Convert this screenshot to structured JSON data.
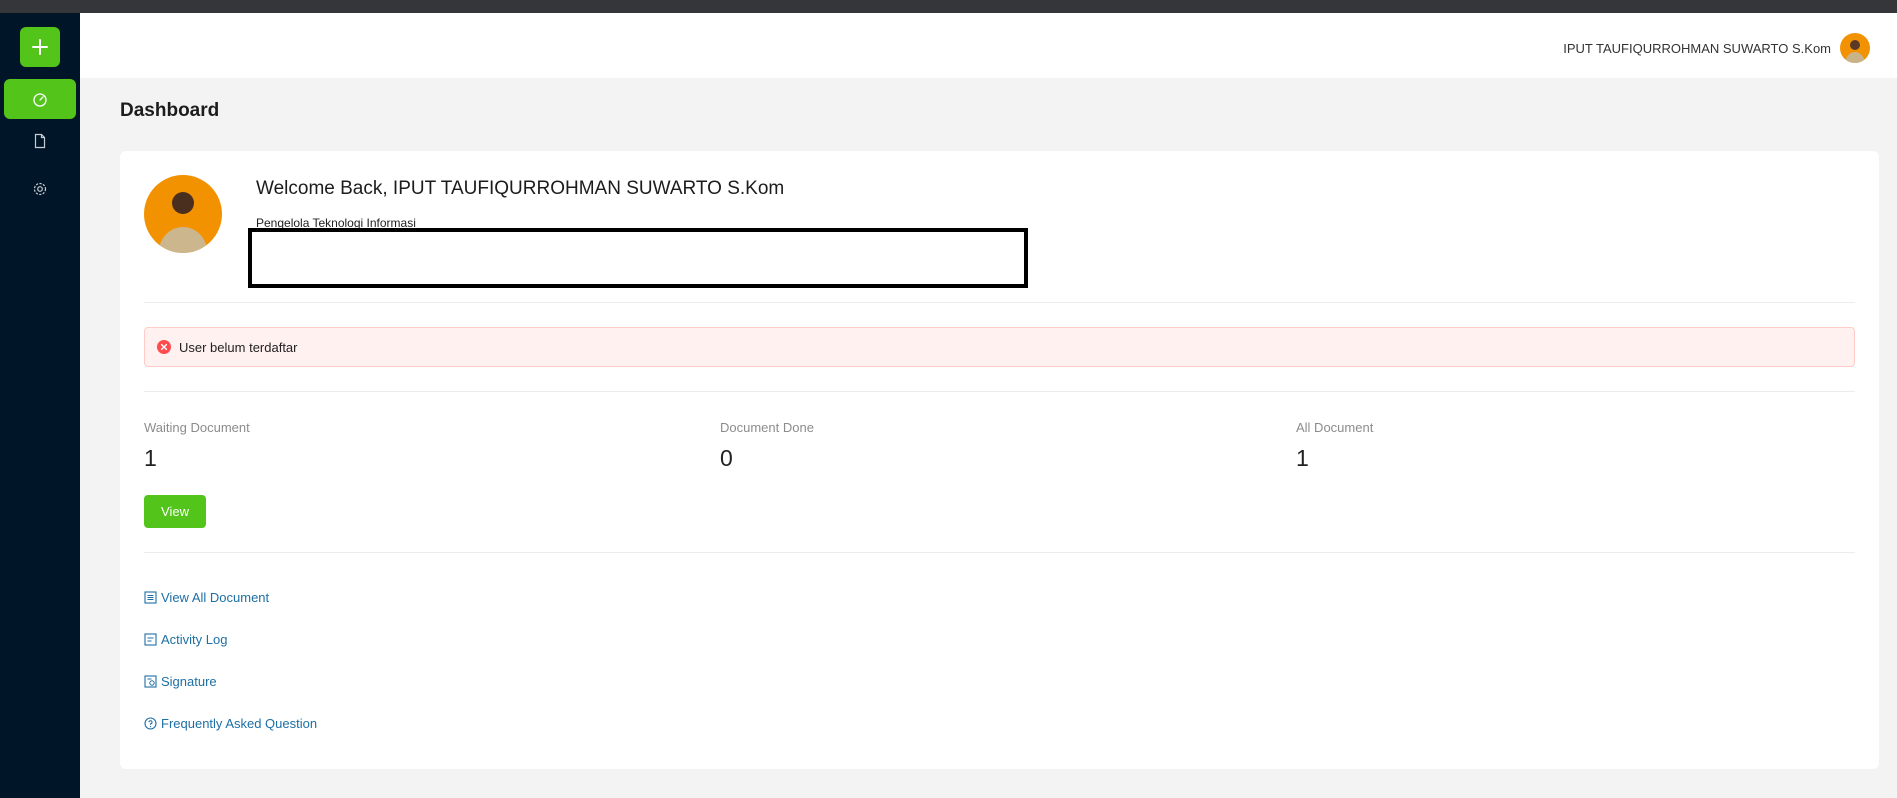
{
  "colors": {
    "accent": "#52c41a",
    "sidebar": "#001628",
    "link": "#1d6fa5",
    "error": "#ff4d4f"
  },
  "sidebar": {
    "items": [
      {
        "name": "dashboard",
        "icon": "dashboard-icon",
        "active": true
      },
      {
        "name": "documents",
        "icon": "file-icon",
        "active": false
      },
      {
        "name": "settings",
        "icon": "gear-icon",
        "active": false
      }
    ]
  },
  "header": {
    "user_name": "IPUT TAUFIQURROHMAN SUWARTO S.Kom"
  },
  "page": {
    "title": "Dashboard"
  },
  "profile": {
    "welcome": "Welcome Back, IPUT TAUFIQURROHMAN SUWARTO S.Kom",
    "job_title": "Pengelola Teknologi Informasi"
  },
  "alert": {
    "message": "User belum terdaftar"
  },
  "stats": [
    {
      "label": "Waiting Document",
      "value": "1"
    },
    {
      "label": "Document Done",
      "value": "0"
    },
    {
      "label": "All Document",
      "value": "1"
    }
  ],
  "view_button": {
    "label": "View"
  },
  "links": [
    {
      "label": "View All Document",
      "icon": "list-icon"
    },
    {
      "label": "Activity Log",
      "icon": "log-icon"
    },
    {
      "label": "Signature",
      "icon": "signature-icon"
    },
    {
      "label": "Frequently Asked Question",
      "icon": "question-icon"
    }
  ]
}
